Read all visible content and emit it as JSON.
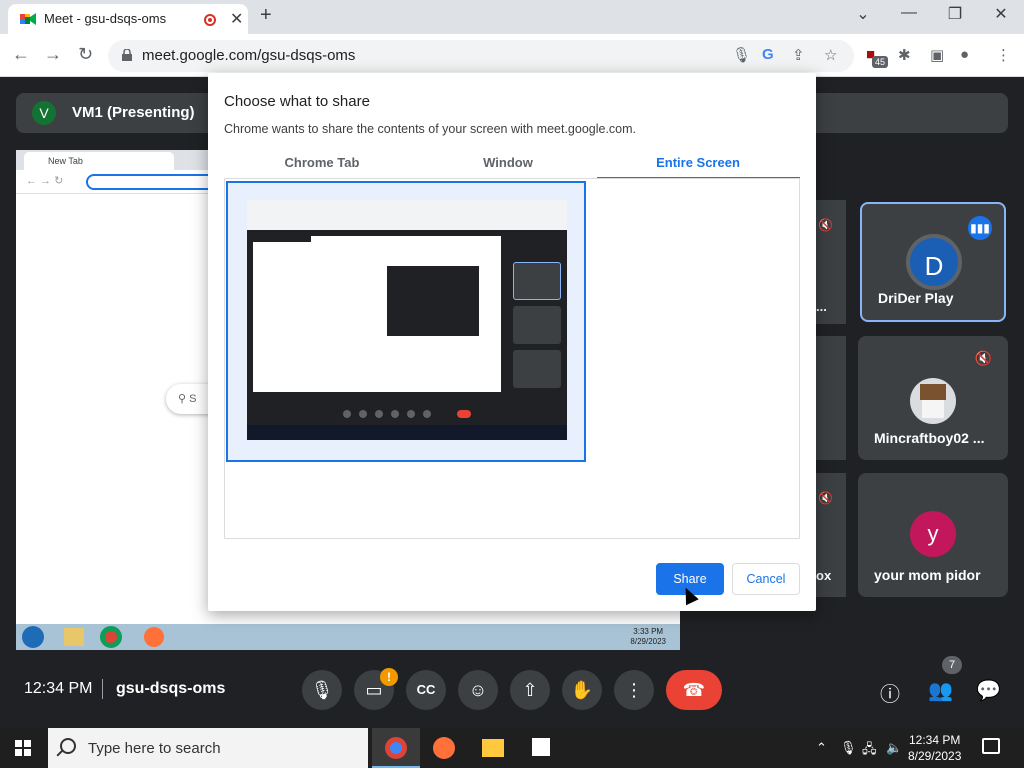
{
  "browser": {
    "tab_title": "Meet - gsu-dsqs-oms",
    "url": "meet.google.com/gsu-dsqs-oms",
    "extension_badge": "45"
  },
  "meet": {
    "presenter_initial": "V",
    "presenter_label": "VM1 (Presenting)",
    "participants": [
      {
        "initial": "D",
        "name": "DriDer Play",
        "avatar_color": "#1a5fb4"
      },
      {
        "initial": "",
        "name": "Mincraftboy02 ...",
        "avatar_color": "#dadce0"
      },
      {
        "initial": "y",
        "name": "your mom pidor",
        "avatar_color": "#c2185b"
      }
    ],
    "clipped_tiles": [
      "...",
      "",
      "ox"
    ],
    "time": "12:34 PM",
    "meeting_code": "gsu-dsqs-oms",
    "people_count": "7",
    "warning_mark": "!"
  },
  "shared_screen": {
    "tab_title": "New Tab",
    "search_text": "S",
    "clock_time": "3:33 PM",
    "clock_date": "8/29/2023"
  },
  "dialog": {
    "title": "Choose what to share",
    "subtitle": "Chrome wants to share the contents of your screen with meet.google.com.",
    "tabs": [
      "Chrome Tab",
      "Window",
      "Entire Screen"
    ],
    "active_tab": "Entire Screen",
    "share_label": "Share",
    "cancel_label": "Cancel"
  },
  "taskbar": {
    "search_placeholder": "Type here to search",
    "clock_time": "12:34 PM",
    "clock_date": "8/29/2023"
  }
}
